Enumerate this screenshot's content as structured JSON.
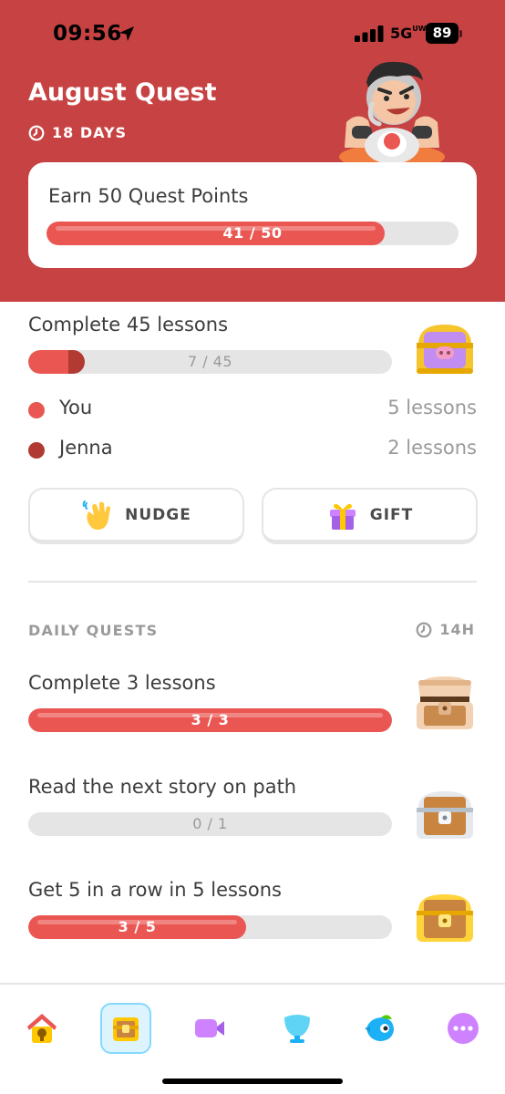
{
  "status_bar": {
    "time": "09:56",
    "network": "5G",
    "network_superscript": "UW",
    "battery": "89"
  },
  "header": {
    "title": "August Quest",
    "days_left": "18 DAYS",
    "background_color": "#c74242"
  },
  "monthly_quest": {
    "label": "Earn 50 Quest Points",
    "progress_text": "41 / 50",
    "progress": 0.82
  },
  "friends_quest": {
    "label": "Complete 45 lessons",
    "progress_text": "7 / 45",
    "progress_you": 0.111,
    "progress_friend": 0.044,
    "participants": [
      {
        "name": "You",
        "value": "5 lessons",
        "color": "#ea5753"
      },
      {
        "name": "Jenna",
        "value": "2 lessons",
        "color": "#b13b32"
      }
    ],
    "nudge_label": "NUDGE",
    "gift_label": "GIFT",
    "reward_icon": "purple-gold-chest-icon"
  },
  "daily_quests": {
    "heading": "DAILY QUESTS",
    "timer": "14H",
    "items": [
      {
        "label": "Complete 3 lessons",
        "progress_text": "3 / 3",
        "progress": 1.0,
        "reward_icon": "opened-chest-icon"
      },
      {
        "label": "Read the next story on path",
        "progress_text": "0 / 1",
        "progress": 0.0,
        "reward_icon": "silver-chest-icon"
      },
      {
        "label": "Get 5 in a row in 5 lessons",
        "progress_text": "3 / 5",
        "progress": 0.6,
        "reward_icon": "gold-chest-icon"
      }
    ]
  },
  "bottom_nav": {
    "items": [
      "home-icon",
      "quests-icon",
      "video-call-icon",
      "leagues-icon",
      "practice-icon",
      "more-icon"
    ],
    "active": "quests-icon"
  },
  "colors": {
    "accent": "#ea5753",
    "friend": "#b13b32",
    "track": "#e5e5e5",
    "muted_text": "#9a9a9a"
  }
}
